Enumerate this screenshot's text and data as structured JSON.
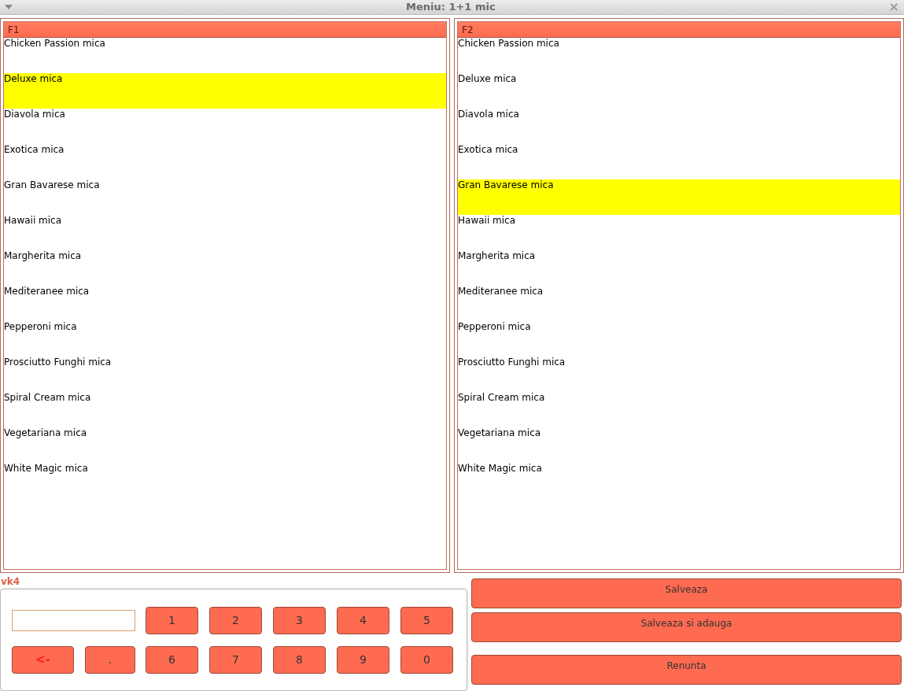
{
  "window": {
    "title": "Meniu: 1+1 mic",
    "close": "×"
  },
  "lists": [
    {
      "header": "F1",
      "items": [
        {
          "label": "Chicken Passion mica",
          "selected": false
        },
        {
          "label": "Deluxe mica",
          "selected": true
        },
        {
          "label": "Diavola mica",
          "selected": false
        },
        {
          "label": "Exotica mica",
          "selected": false
        },
        {
          "label": "Gran Bavarese mica",
          "selected": false
        },
        {
          "label": "Hawaii mica",
          "selected": false
        },
        {
          "label": "Margherita mica",
          "selected": false
        },
        {
          "label": "Mediteranee mica",
          "selected": false
        },
        {
          "label": "Pepperoni mica",
          "selected": false
        },
        {
          "label": "Prosciutto Funghi mica",
          "selected": false
        },
        {
          "label": "Spiral Cream mica",
          "selected": false
        },
        {
          "label": "Vegetariana mica",
          "selected": false
        },
        {
          "label": "White Magic mica",
          "selected": false
        }
      ]
    },
    {
      "header": "F2",
      "items": [
        {
          "label": "Chicken Passion mica",
          "selected": false
        },
        {
          "label": "Deluxe mica",
          "selected": false
        },
        {
          "label": "Diavola mica",
          "selected": false
        },
        {
          "label": "Exotica mica",
          "selected": false
        },
        {
          "label": "Gran Bavarese mica",
          "selected": true
        },
        {
          "label": "Hawaii mica",
          "selected": false
        },
        {
          "label": "Margherita mica",
          "selected": false
        },
        {
          "label": "Mediteranee mica",
          "selected": false
        },
        {
          "label": "Pepperoni mica",
          "selected": false
        },
        {
          "label": "Prosciutto Funghi mica",
          "selected": false
        },
        {
          "label": "Spiral Cream mica",
          "selected": false
        },
        {
          "label": "Vegetariana mica",
          "selected": false
        },
        {
          "label": "White Magic mica",
          "selected": false
        }
      ]
    }
  ],
  "keypad": {
    "label": "vk4",
    "keys_row_1": [
      {
        "label": "1",
        "kind": "digit"
      },
      {
        "label": "2",
        "kind": "digit"
      },
      {
        "label": "3",
        "kind": "digit"
      },
      {
        "label": "4",
        "kind": "digit"
      },
      {
        "label": "5",
        "kind": "digit"
      }
    ],
    "keys_row_2": [
      {
        "label": "<-",
        "kind": "backspace"
      },
      {
        "label": ".",
        "kind": "digit"
      },
      {
        "label": "6",
        "kind": "digit"
      },
      {
        "label": "7",
        "kind": "digit"
      },
      {
        "label": "8",
        "kind": "digit"
      },
      {
        "label": "9",
        "kind": "digit"
      },
      {
        "label": "0",
        "kind": "digit"
      }
    ]
  },
  "actions": [
    "Salveaza",
    "Salveaza si adauga",
    "Renunta"
  ]
}
